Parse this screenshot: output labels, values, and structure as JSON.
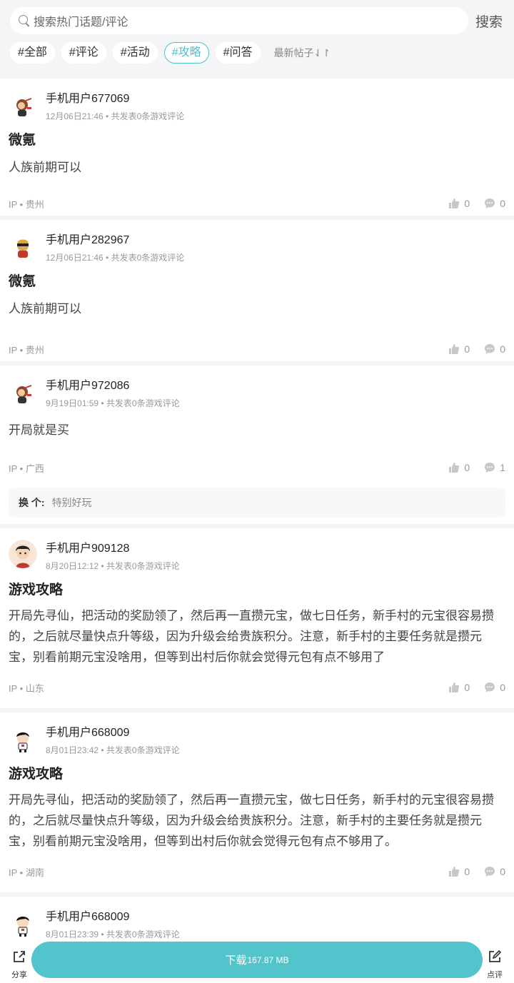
{
  "search": {
    "placeholder": "搜索热门话题/评论",
    "button": "搜索"
  },
  "tags": [
    "#全部",
    "#评论",
    "#活动",
    "#攻略",
    "#问答"
  ],
  "active_tag_index": 3,
  "sort_label": "最新帖子⇃↾",
  "posts": [
    {
      "user": "手机用户677069",
      "meta": "12月06日21:46 • 共发表0条游戏评论",
      "title": "微氪",
      "body": "人族前期可以",
      "ip": "IP • 贵州",
      "likes": "0",
      "comments": "0",
      "avatar": "monkey-avatar"
    },
    {
      "user": "手机用户282967",
      "meta": "12月06日21:46 • 共发表0条游戏评论",
      "title": "微氪",
      "body": "人族前期可以",
      "ip": "IP • 贵州",
      "likes": "0",
      "comments": "0",
      "avatar": "bandit-avatar"
    },
    {
      "user": "手机用户972086",
      "meta": "9月19日01:59 • 共发表0条游戏评论",
      "title": "",
      "body": "开局就是买",
      "ip": "IP • 广西",
      "likes": "0",
      "comments": "1",
      "avatar": "monkey-avatar",
      "reply": {
        "user": "换 个:",
        "text": "特别好玩"
      }
    },
    {
      "user": "手机用户909128",
      "meta": "8月20日12:12 • 共发表0条游戏评论",
      "title": "游戏攻略",
      "body": "开局先寻仙，把活动的奖励领了，然后再一直攒元宝，做七日任务，新手村的元宝很容易攒的，之后就尽量快点升等级，因为升级会给贵族积分。注意，新手村的主要任务就是攒元宝，别看前期元宝没啥用，但等到出村后你就会觉得元包有点不够用了",
      "ip": "IP • 山东",
      "likes": "0",
      "comments": "0",
      "avatar": "boy-avatar"
    },
    {
      "user": "手机用户668009",
      "meta": "8月01日23:42 • 共发表0条游戏评论",
      "title": "游戏攻略",
      "body": "开局先寻仙，把活动的奖励领了，然后再一直攒元宝，做七日任务，新手村的元宝很容易攒的，之后就尽量快点升等级，因为升级会给贵族积分。注意，新手村的主要任务就是攒元宝，别看前期元宝没啥用，但等到出村后你就会觉得元包有点不够用了。",
      "ip": "IP • 湖南",
      "likes": "0",
      "comments": "0",
      "avatar": "cartoon-kid-avatar"
    },
    {
      "user": "手机用户668009",
      "meta": "8月01日23:39 • 共发表0条游戏评论",
      "title": "",
      "body": "",
      "ip": "",
      "likes": "",
      "comments": "",
      "avatar": "cartoon-kid-avatar"
    }
  ],
  "bottom": {
    "share_label": "分享",
    "download_label": "下载",
    "download_size": "167.87 MB",
    "review_label": "点评"
  },
  "colors": {
    "accent": "#53c3cc",
    "tag_active": "#4fc1cc",
    "background": "#f4f5f7"
  }
}
